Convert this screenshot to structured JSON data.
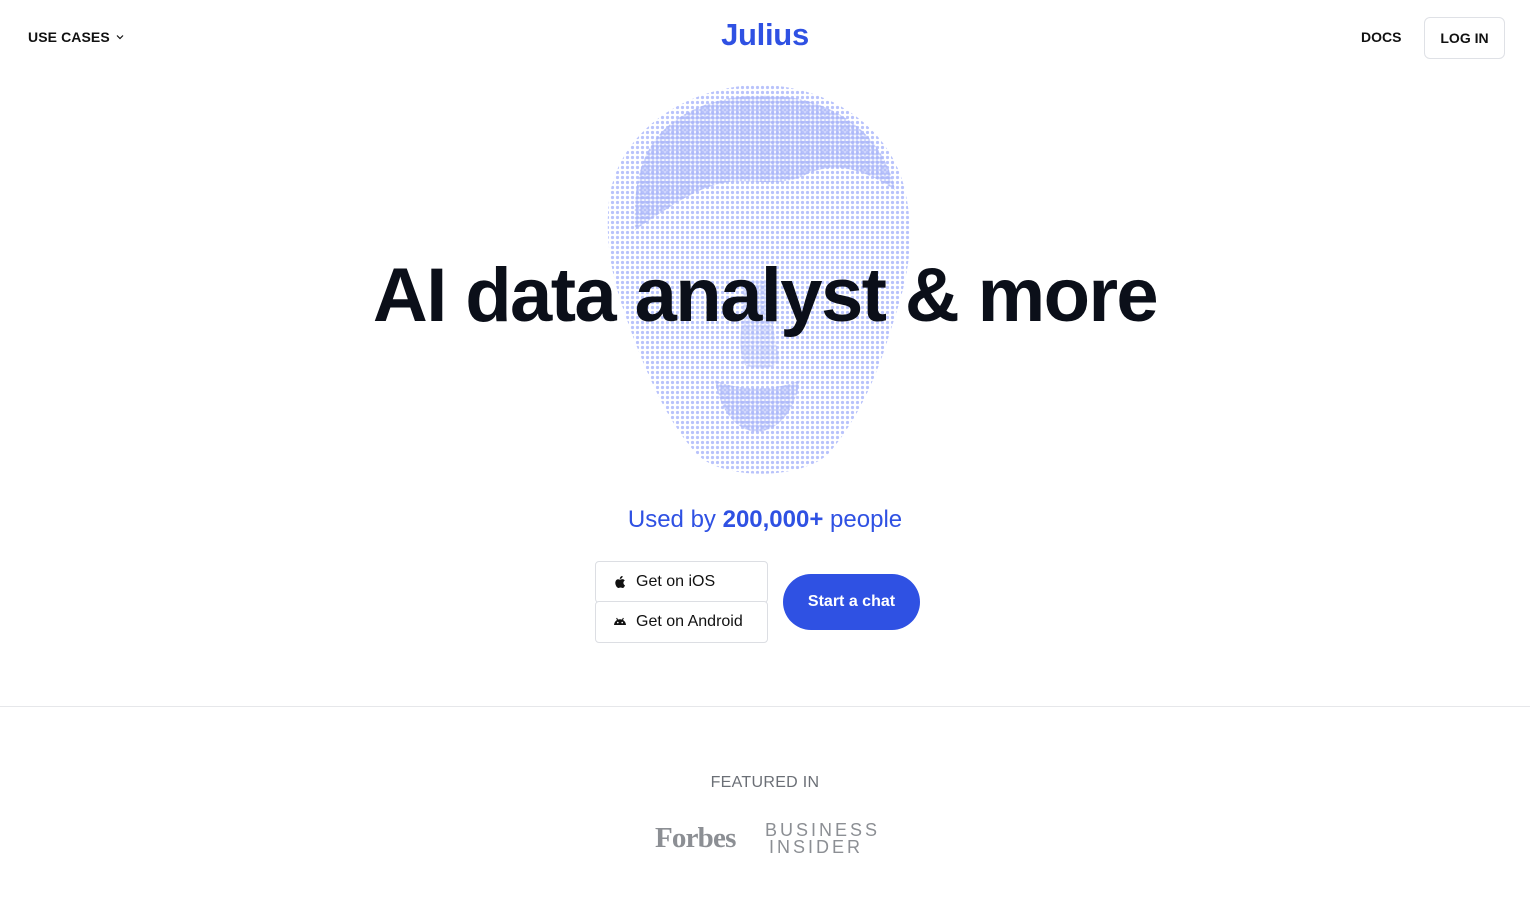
{
  "nav": {
    "use_cases": "USE CASES",
    "logo": "Julius",
    "docs": "DOCS",
    "login": "LOG IN"
  },
  "hero": {
    "headline": "AI data analyst & more",
    "used_by_prefix": "Used by",
    "used_by_count": "200,000+",
    "used_by_suffix": "people",
    "ios_label": "Get on iOS",
    "android_label": "Get on Android",
    "cta_label": "Start a chat"
  },
  "featured": {
    "heading": "FEATURED IN",
    "logos": [
      "Forbes",
      "BUSINESS",
      "INSIDER"
    ]
  },
  "colors": {
    "brand": "#2f51e3",
    "bust_dots": "#b9c3fb"
  }
}
